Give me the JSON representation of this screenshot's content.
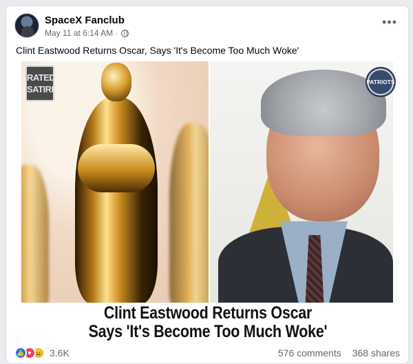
{
  "post": {
    "page_name": "SpaceX Fanclub",
    "date": "May 11 at 6:14 AM",
    "dot_separator": "·",
    "privacy_icon": "globe-icon",
    "more_icon": "more-options-icon",
    "more_glyph": "•••",
    "caption": "Clint Eastwood Returns Oscar, Says 'It's Become Too Much Woke'"
  },
  "image": {
    "badge_left_line1": "RATED",
    "badge_left_line2": "SATIRE",
    "badge_right": "PATRIOTS",
    "headline_line1": "Clint Eastwood Returns Oscar",
    "headline_line2": "Says 'It's Become Too Much Woke'"
  },
  "footer": {
    "reaction_icons": [
      "like-icon",
      "love-icon",
      "haha-icon"
    ],
    "reaction_count": "3.6K",
    "comments": "576 comments",
    "shares": "368 shares"
  },
  "colors": {
    "like": "#1877f2",
    "love": "#f33e58",
    "haha": "#f7b928",
    "secondary_text": "#65676b"
  }
}
